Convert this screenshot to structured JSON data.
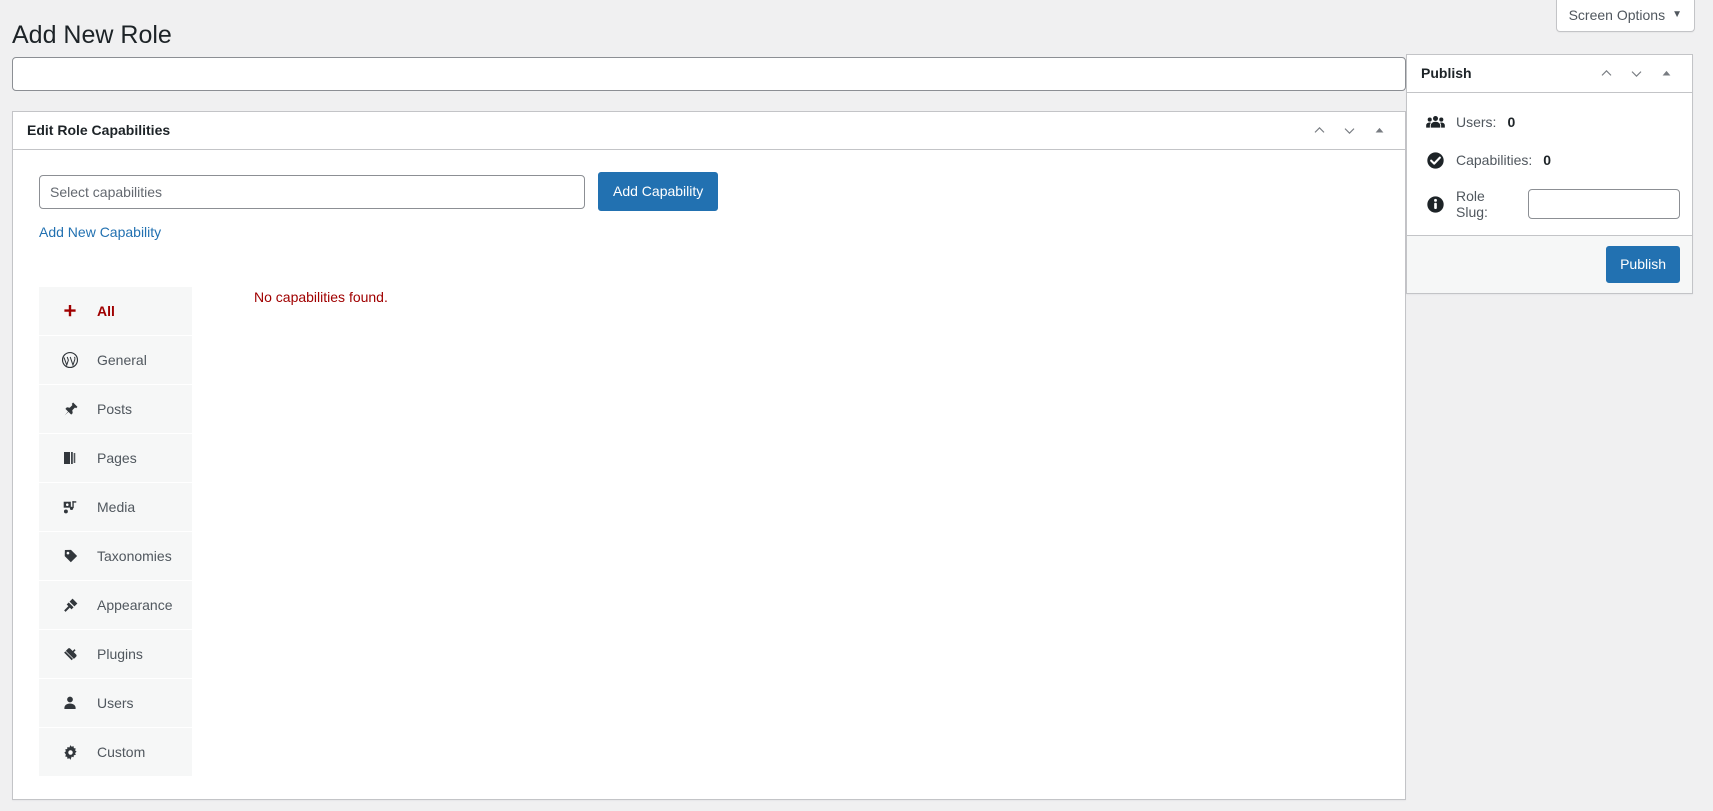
{
  "screen_options": {
    "label": "Screen Options",
    "caret_icon": "chevron-down-icon"
  },
  "page": {
    "title": "Add New Role"
  },
  "role_name": {
    "value": "",
    "placeholder": ""
  },
  "metabox": {
    "title": "Edit Role Capabilities",
    "handle_actions": [
      "order-higher-icon",
      "order-lower-icon",
      "toggle-icon"
    ],
    "select_capabilities": {
      "value": "",
      "placeholder": "Select capabilities"
    },
    "add_capability_label": "Add Capability",
    "add_new_capability_label": "Add New Capability",
    "empty_message": "No capabilities found.",
    "nav_items": [
      {
        "label": "All",
        "icon": "plus-icon",
        "active": true
      },
      {
        "label": "General",
        "icon": "wordpress-icon",
        "active": false
      },
      {
        "label": "Posts",
        "icon": "pin-icon",
        "active": false
      },
      {
        "label": "Pages",
        "icon": "pages-icon",
        "active": false
      },
      {
        "label": "Media",
        "icon": "media-icon",
        "active": false
      },
      {
        "label": "Taxonomies",
        "icon": "tag-icon",
        "active": false
      },
      {
        "label": "Appearance",
        "icon": "brush-icon",
        "active": false
      },
      {
        "label": "Plugins",
        "icon": "plug-icon",
        "active": false
      },
      {
        "label": "Users",
        "icon": "user-icon",
        "active": false
      },
      {
        "label": "Custom",
        "icon": "gear-icon",
        "active": false
      }
    ]
  },
  "publish_box": {
    "title": "Publish",
    "handle_actions": [
      "order-higher-icon",
      "order-lower-icon",
      "toggle-icon"
    ],
    "users_label": "Users:",
    "users_count": "0",
    "capabilities_label": "Capabilities:",
    "capabilities_count": "0",
    "role_slug_label": "Role Slug:",
    "role_slug_value": "",
    "publish_label": "Publish"
  },
  "colors": {
    "accent_blue": "#2271b1",
    "danger_red": "#a00000",
    "page_bg": "#f0f0f1",
    "border": "#c3c4c7"
  }
}
